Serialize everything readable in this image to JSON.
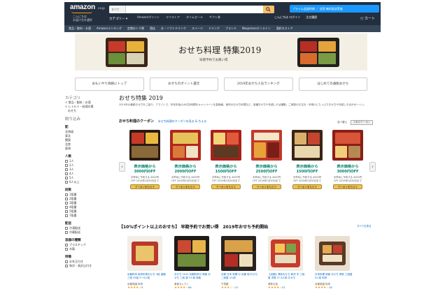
{
  "header": {
    "logo": "amazon",
    "logo_suffix": ".co.jp",
    "deliver_line1": "こんにちは",
    "deliver_line2": "お届け先を選択",
    "search_category": "すべて",
    "search_placeholder": "",
    "prime_banner": "プライム会員特典  ／ 全国 無料配送実施",
    "category_label": "カテゴリー ▾",
    "nav_links": [
      "Amazonポイント",
      "マイストア",
      "タイムセール",
      "ギフト券",
      "Amazonでお売り",
      "ヘルプ"
    ],
    "account_links": [
      "こんにちは ログイン",
      "アカウント&リスト ▾",
      "注文履歴",
      "今すぐ登録 プライム ▾"
    ],
    "cart_label": "カート",
    "subnav": [
      "食品・飲料・お酒",
      "Amazonランキング",
      "定期おトク便",
      "酒店",
      "水・ソフトドリンク",
      "スイーツ",
      "ドリンク",
      "ブランド",
      "Nespressoオンライン",
      "酒好きストア"
    ]
  },
  "hero": {
    "title": "おせち料理 特集2019",
    "subtitle": "早期予約でお買い得"
  },
  "top_tabs": [
    "おもいやり価格にトップ",
    "おせちのポイント還元",
    "2019年おせち人気ランキング",
    "はじめての通販おせち"
  ],
  "sidebar": {
    "heading": "カテゴリ",
    "category_items": [
      "< 食品・飲料・お酒",
      "< レトルト・料理の素",
      "おせち"
    ],
    "filter_heading": "絞り込み",
    "shipping_heading": "配",
    "shipping_items": [
      "北海道",
      "東北",
      "関東",
      "北陸",
      "東海"
    ],
    "people_heading": "人数",
    "people_items": [
      "1人",
      "2人",
      "3人",
      "4人",
      "5人",
      "6人以上"
    ],
    "size_heading": "段数",
    "size_items": [
      "1段重",
      "2段重",
      "3段重",
      "4段重",
      "5段重",
      "7段重"
    ],
    "delivery_heading": "配送",
    "delivery_items": [
      "冷凍配送",
      "冷蔵配送"
    ],
    "container_heading": "容器の種類",
    "container_items": [
      "プラスチック",
      "木製"
    ],
    "misc_heading": "特徴",
    "misc_items": [
      "お年玉付き",
      "和洋・具沢山付き"
    ]
  },
  "main": {
    "title": "おせち特集 2019",
    "description": "2019年の最新おせちをご紹介。アマゾンで、年末年始の大切な時間をキャンペーンを高価格、食材のおせち料理など、各種おせちや年越しそば通販。ご家族のお正月・年明けにたっぷりおせちや年越しそばがポートン。",
    "coupon_heading": "おせち料理のクーポン",
    "coupon_link": "おせち料理のクーポンを見る & ちえる",
    "coupon_right": "並べ替え",
    "coupon_sort": "人気のクーポン"
  },
  "coupons": [
    {
      "price": "表示価格から\n3000円OFF",
      "sub": "お早めに予約する 4000円\nOFF 2019年1月30日まで",
      "button": "クーポンをもらう"
    },
    {
      "price": "表示価格から\n2000円OFF",
      "sub": "お早めに予約する 4000円\nOFF 2019年1月30日まで",
      "button": "クーポンをもらう"
    },
    {
      "price": "表示価格から\n1500円OFF",
      "sub": "お早めに予約する 4000円\nOFF 2019年1月30日まで",
      "button": "クーポンをもらう"
    },
    {
      "price": "表示価格から\n2500円OFF",
      "sub": "お早めに予約する 4000円\nOFF 2019年1月30日まで",
      "button": "クーポンをもらう"
    },
    {
      "price": "表示価格から\n1500円OFF",
      "sub": "お早めに予約する 4000円\nOFF 2019年1月30日まで",
      "button": "クーポンをもらう"
    },
    {
      "price": "表示価格から\n3000円OFF",
      "sub": "お早めに予約する 4000円\nOFF 2019年1月30日まで",
      "button": "クーポンをもらう"
    }
  ],
  "section2": {
    "title": "【10%ポイント以上のおせち】 早期予約でお買い得　2019年おせち予約開始",
    "link": "すべてを見る",
    "items": [
      {
        "title": "京都料亭 和洋折衷おせち 3段 重箱 三段 35品 3〜4人前",
        "seller": "京都祇園 料亭",
        "stars": "★★★★☆",
        "count": "9"
      },
      {
        "title": "おせち 2019 京都料亭の 和風 おせち 三段 重 5人前 和風",
        "seller": "美食セレクト",
        "stars": "★★★★☆",
        "count": "66"
      },
      {
        "title": "お歳 日本 料理 の 京都 和 おせち 二段重 4人前",
        "seller": "千賀屋",
        "stars": "★★★☆☆",
        "count": "47"
      },
      {
        "title": "【京都】博多おせち 和洋 中 三段重 洋風 3〜4人前 おせち",
        "seller": "博多久松",
        "stars": "★★★★☆",
        "count": "52"
      },
      {
        "title": "日本料理 和食 おせち 博多 三段重 5人前 料亭",
        "seller": "京都祇園 料亭",
        "stars": "★★★★☆",
        "count": "18"
      }
    ]
  }
}
